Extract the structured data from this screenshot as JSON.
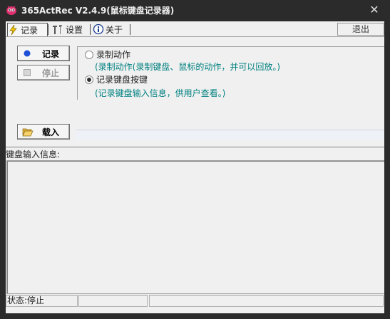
{
  "window": {
    "title": "365ActRec V2.4.9(鼠标键盘记录器)",
    "close_symbol": "✕"
  },
  "toolbar": {
    "record_tab": "记录",
    "settings_tab": "设置",
    "about_tab": "关于",
    "exit_label": "退出",
    "icons": {
      "record": "lightning-icon",
      "settings": "tools-icon",
      "about": "info-icon"
    }
  },
  "controls": {
    "record_label": "记录",
    "stop_label": "停止",
    "load_label": "载入"
  },
  "modes": {
    "action": {
      "label": "录制动作",
      "desc": "(录制动作(录制键盘、鼠标的动作，并可以回放。)",
      "selected": false
    },
    "keys": {
      "label": "记录键盘按键",
      "desc": "(记录键盘输入信息，供用户查看。)",
      "selected": true
    }
  },
  "keyboard_log": {
    "label": "键盘输入信息:",
    "content": ""
  },
  "status": {
    "text": "状态:停止"
  },
  "colors": {
    "accent_teal": "#008080",
    "record_dot": "#1e4fd8",
    "titlebar": "#2b2b2b"
  }
}
